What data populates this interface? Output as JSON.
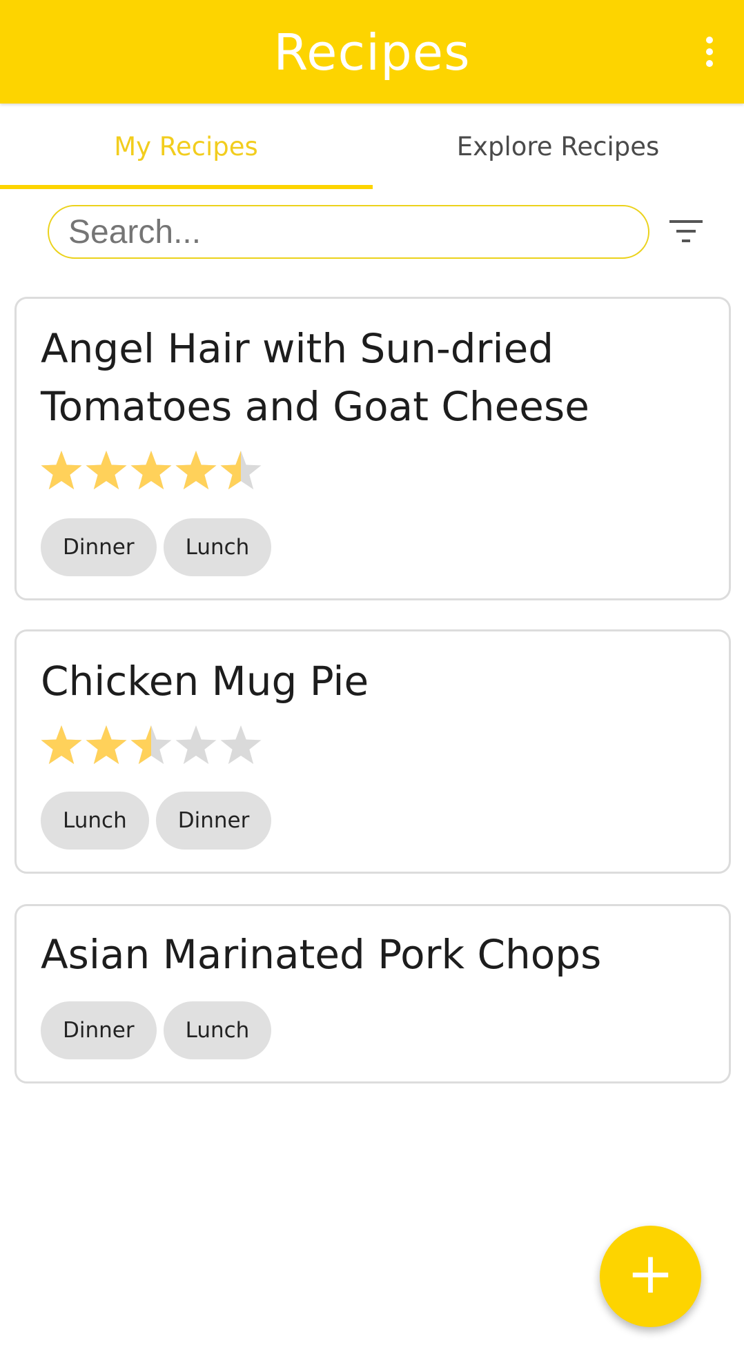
{
  "appbar": {
    "title": "Recipes",
    "overflow_icon": "more-vert-icon"
  },
  "tabs": {
    "my": "My Recipes",
    "explore": "Explore Recipes"
  },
  "search": {
    "placeholder": "Search...",
    "value": "",
    "filter_icon": "filter-list-icon"
  },
  "recipes": [
    {
      "name": "Angel Hair with Sun-dried Tomatoes and Goat Cheese",
      "rating": 4.5,
      "tags": [
        "Dinner",
        "Lunch"
      ]
    },
    {
      "name": "Chicken Mug Pie",
      "rating": 2.5,
      "tags": [
        "Lunch",
        "Dinner"
      ]
    },
    {
      "name": "Asian Marinated Pork Chops",
      "rating": null,
      "tags": [
        "Dinner",
        "Lunch"
      ]
    }
  ],
  "fab": {
    "label": "+",
    "icon": "add-icon"
  },
  "colors": {
    "accent": "#FDD400",
    "tab_active": "#F2CD1E",
    "star_filled": "#FFD15A",
    "star_empty": "#DADADA",
    "chip_bg": "#E0E0E0"
  }
}
